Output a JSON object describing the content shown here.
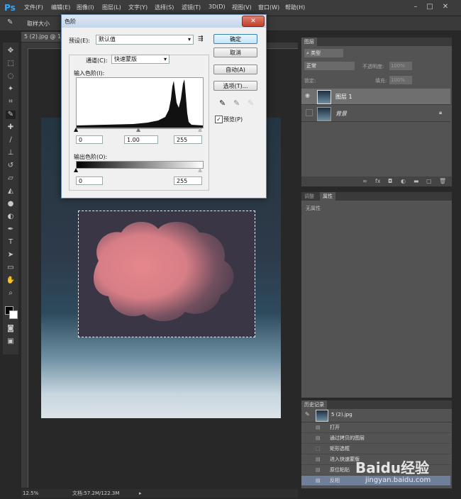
{
  "app": {
    "logo": "Ps"
  },
  "menubar": {
    "items": [
      "文件(F)",
      "编辑(E)",
      "图像(I)",
      "图层(L)",
      "文字(Y)",
      "选择(S)",
      "滤镜(T)",
      "3D(D)",
      "视图(V)",
      "窗口(W)",
      "帮助(H)"
    ],
    "window_buttons": [
      "–",
      "□",
      "✕"
    ]
  },
  "options_bar": {
    "sample_size_label": "取样大小"
  },
  "document": {
    "tab_label": "5 (2).jpg @ 1"
  },
  "dialog": {
    "title": "色阶",
    "preset_label": "预设(E):",
    "preset_value": "默认值",
    "channel_label": "通道(C):",
    "channel_value": "快速蒙版",
    "input_levels_label": "输入色阶(I):",
    "input_values": [
      "0",
      "1.00",
      "255"
    ],
    "output_levels_label": "输出色阶(O):",
    "output_values": [
      "0",
      "255"
    ],
    "buttons": {
      "ok": "确定",
      "cancel": "取消",
      "auto": "自动(A)",
      "options": "选项(T)..."
    },
    "preview_label": "预览(P)",
    "preview_checked": true
  },
  "layers_panel": {
    "tab": "图层",
    "filter_label": "类型",
    "blend_mode": "正常",
    "opacity_label": "不透明度:",
    "opacity_value": "100%",
    "lock_label": "锁定:",
    "fill_label": "填充:",
    "fill_value": "100%",
    "layers": [
      {
        "name": "图层 1",
        "selected": true
      },
      {
        "name": "背景",
        "selected": false
      }
    ]
  },
  "properties_panel": {
    "tabs": [
      "调整",
      "属性"
    ],
    "empty_text": "无属性"
  },
  "history_panel": {
    "tab": "历史记录",
    "snapshot": "5 (2).jpg",
    "items": [
      "打开",
      "通过拷贝的图层",
      "矩形选框",
      "进入快速蒙版",
      "原位粘贴",
      "反相"
    ]
  },
  "status_bar": {
    "zoom": "12.5%",
    "doc_info": "文档:57.2M/122.3M"
  },
  "watermark": {
    "text": "Baidu经验",
    "url": "jingyan.baidu.com"
  }
}
